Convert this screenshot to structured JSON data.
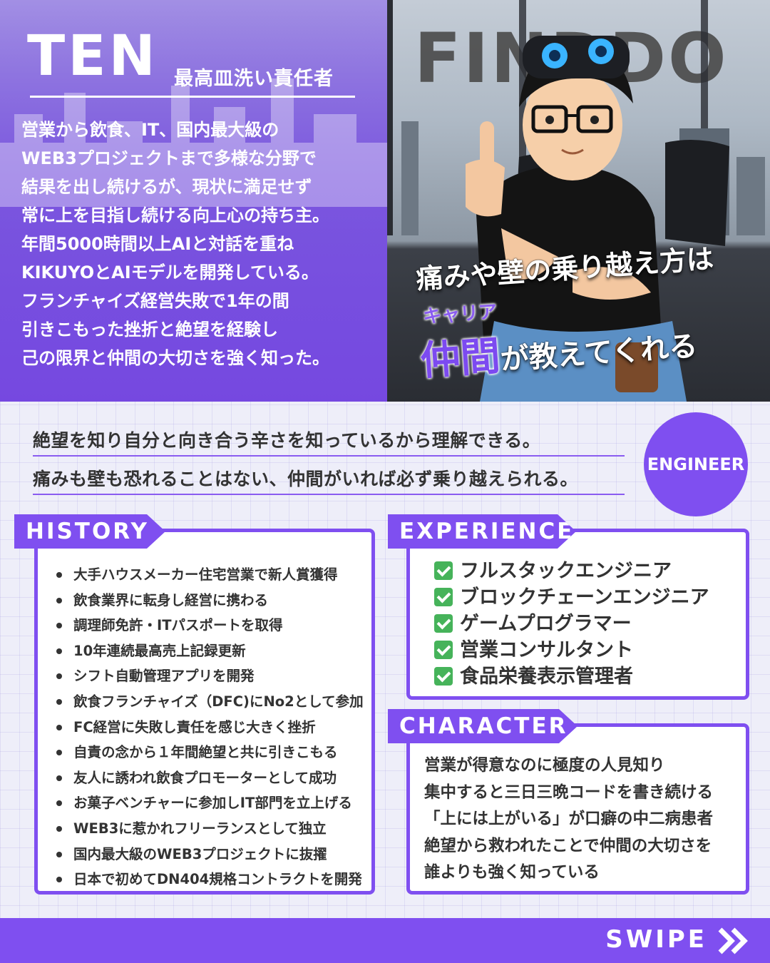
{
  "profile": {
    "name": "TEN",
    "role": "最高皿洗い責任者",
    "bio": [
      "営業から飲食、IT、国内最大級の",
      "WEB3プロジェクトまで多様な分野で",
      "結果を出し続けるが、現状に満足せず",
      "常に上を目指し続ける向上心の持ち主。",
      "年間5000時間以上AIと対話を重ね",
      "KIKUYOとAIモデルを開発している。",
      "フランチャイズ経営失敗で1年の間",
      "引きこもった挫折と絶望を経験し",
      "己の限界と仲間の大切さを強く知った。"
    ]
  },
  "hero": {
    "brand": "FINDDO",
    "catch_line1": "痛みや壁の乗り越え方は",
    "catch_small": "キャリア",
    "catch_big": "仲間",
    "catch_rest": "が教えてくれる"
  },
  "quote": {
    "line1": "絶望を知り自分と向き合う辛さを知っているから理解できる。",
    "line2": "痛みも壁も恐れることはない、仲間がいれば必ず乗り越えられる。"
  },
  "badge": "ENGINEER",
  "history": {
    "title": "HISTORY",
    "items": [
      "大手ハウスメーカー住宅営業で新人賞獲得",
      "飲食業界に転身し経営に携わる",
      "調理師免許・ITパスポートを取得",
      "10年連続最高売上記録更新",
      "シフト自動管理アプリを開発",
      "飲食フランチャイズ（DFC)にNo2として参加",
      "FC経営に失敗し責任を感じ大きく挫折",
      "自責の念から１年間絶望と共に引きこもる",
      "友人に誘われ飲食プロモーターとして成功",
      "お菓子ベンチャーに参加しIT部門を立上げる",
      "WEB3に惹かれフリーランスとして独立",
      "国内最大級のWEB3プロジェクトに抜擢",
      "日本で初めてDN404規格コントラクトを開発"
    ]
  },
  "experience": {
    "title": "EXPERIENCE",
    "items": [
      "フルスタックエンジニア",
      "ブロックチェーンエンジニア",
      "ゲームプログラマー",
      "営業コンサルタント",
      "食品栄養表示管理者"
    ]
  },
  "character": {
    "title": "CHARACTER",
    "lines": [
      "営業が得意なのに極度の人見知り",
      "集中すると三日三晩コードを書き続ける",
      "「上には上がいる」が口癖の中二病患者",
      "絶望から救われたことで仲間の大切さを",
      "誰よりも強く知っている"
    ]
  },
  "footer": {
    "swipe": "SWIPE"
  },
  "colors": {
    "accent": "#7f4ff0",
    "check": "#46b35a"
  }
}
